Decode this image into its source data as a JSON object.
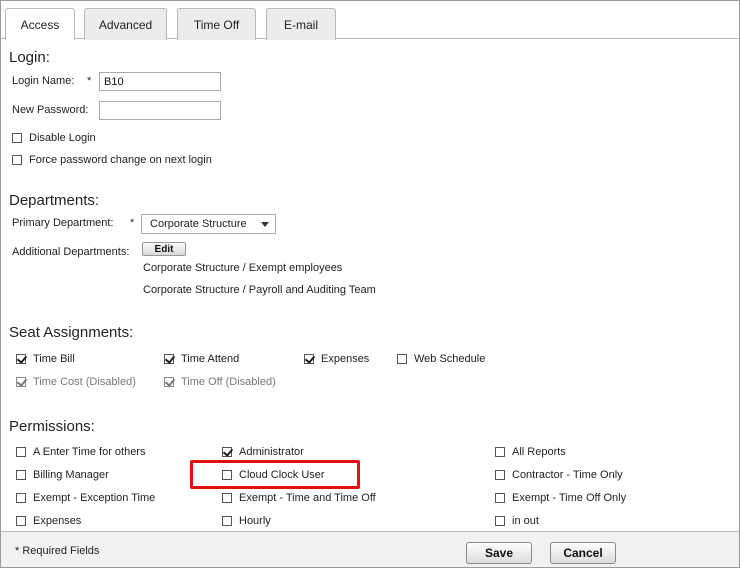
{
  "tabs": [
    {
      "label": "Access",
      "active": true
    },
    {
      "label": "Advanced",
      "active": false
    },
    {
      "label": "Time Off",
      "active": false
    },
    {
      "label": "E-mail",
      "active": false
    }
  ],
  "login": {
    "section_title": "Login:",
    "login_name_label": "Login Name:",
    "login_name_value": "B10",
    "required_marker": "*",
    "new_password_label": "New Password:",
    "new_password_value": "",
    "disable_login": {
      "label": "Disable Login",
      "checked": false
    },
    "force_password_change": {
      "label": "Force password change on next login",
      "checked": false
    }
  },
  "departments": {
    "section_title": "Departments:",
    "primary_label": "Primary Department:",
    "primary_value": "Corporate Structure",
    "additional_label": "Additional Departments:",
    "edit_label": "Edit",
    "additional_items": [
      "Corporate Structure / Exempt employees",
      "Corporate Structure / Payroll and Auditing Team"
    ]
  },
  "seats": {
    "section_title": "Seat Assignments:",
    "items": [
      {
        "label": "Time Bill",
        "checked": true,
        "disabled": false
      },
      {
        "label": "Time Attend",
        "checked": true,
        "disabled": false
      },
      {
        "label": "Expenses",
        "checked": true,
        "disabled": false
      },
      {
        "label": "Web Schedule",
        "checked": false,
        "disabled": false
      },
      {
        "label": "Time Cost (Disabled)",
        "checked": true,
        "disabled": true
      },
      {
        "label": "Time Off (Disabled)",
        "checked": true,
        "disabled": true
      }
    ]
  },
  "permissions": {
    "section_title": "Permissions:",
    "items": [
      {
        "label": "A Enter Time for others",
        "checked": false
      },
      {
        "label": "Administrator",
        "checked": true
      },
      {
        "label": "All Reports",
        "checked": false
      },
      {
        "label": "Billing Manager",
        "checked": false
      },
      {
        "label": "Cloud Clock User",
        "checked": false
      },
      {
        "label": "Contractor - Time Only",
        "checked": false
      },
      {
        "label": "Exempt - Exception Time",
        "checked": false
      },
      {
        "label": "Exempt - Time and Time Off",
        "checked": false
      },
      {
        "label": "Exempt - Time Off Only",
        "checked": false
      },
      {
        "label": "Expenses",
        "checked": false
      },
      {
        "label": "Hourly",
        "checked": false
      },
      {
        "label": "in out",
        "checked": false
      }
    ]
  },
  "footer": {
    "required_note": "* Required Fields",
    "save_label": "Save",
    "cancel_label": "Cancel"
  },
  "colors": {
    "highlight": "#e01010"
  }
}
